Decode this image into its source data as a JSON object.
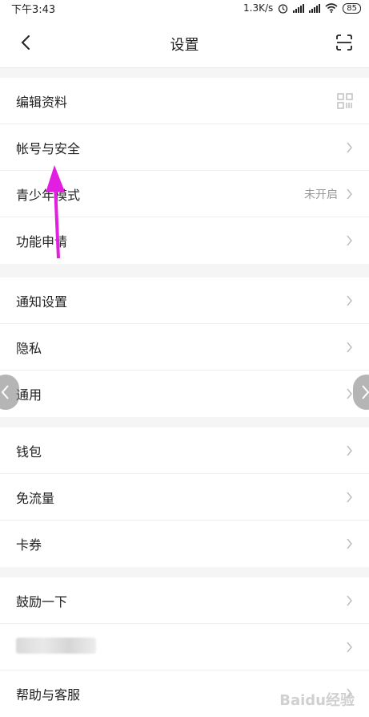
{
  "status_bar": {
    "time": "下午3:43",
    "network_speed": "1.3K/s",
    "battery": "85",
    "hd_label": "HD"
  },
  "header": {
    "title": "设置",
    "back_icon": "chevron-left-icon",
    "scan_icon": "scan-icon"
  },
  "groups": [
    {
      "items": [
        {
          "label": "编辑资料",
          "trailing": "qr-icon"
        },
        {
          "label": "帐号与安全",
          "trailing": "chevron-right-icon"
        },
        {
          "label": "青少年模式",
          "value": "未开启",
          "trailing": "chevron-right-icon"
        },
        {
          "label": "功能申请",
          "trailing": "chevron-right-icon"
        }
      ]
    },
    {
      "items": [
        {
          "label": "通知设置",
          "trailing": "chevron-right-icon"
        },
        {
          "label": "隐私",
          "trailing": "chevron-right-icon"
        },
        {
          "label": "通用",
          "trailing": "chevron-right-icon"
        }
      ]
    },
    {
      "items": [
        {
          "label": "钱包",
          "trailing": "chevron-right-icon"
        },
        {
          "label": "免流量",
          "trailing": "chevron-right-icon"
        },
        {
          "label": "卡券",
          "trailing": "chevron-right-icon"
        }
      ]
    },
    {
      "items": [
        {
          "label": "鼓励一下",
          "trailing": "chevron-right-icon"
        },
        {
          "label": "",
          "blurred": true,
          "trailing": "chevron-right-icon"
        },
        {
          "label": "帮助与客服",
          "trailing": "chevron-right-icon"
        }
      ]
    }
  ],
  "annotation": {
    "color": "#e21ee0",
    "icon": "arrow-annotation-icon"
  },
  "watermark": "Baidu经验"
}
